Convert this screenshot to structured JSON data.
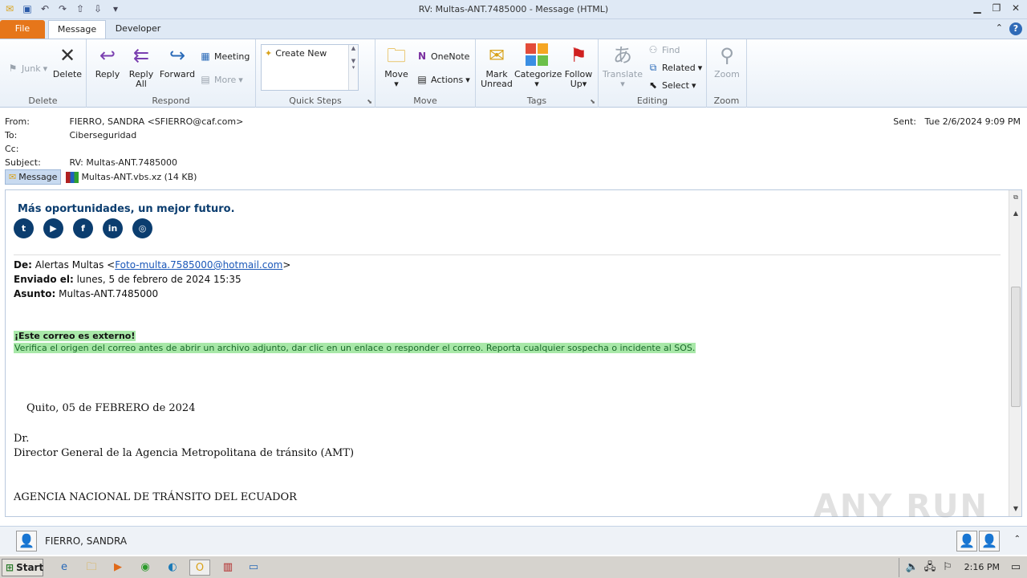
{
  "window": {
    "title": "RV: Multas-ANT.7485000 - Message (HTML)"
  },
  "tabs": [
    {
      "label": "File"
    },
    {
      "label": "Message"
    },
    {
      "label": "Developer"
    }
  ],
  "ribbon": {
    "delete_group": {
      "label": "Delete",
      "junk": "Junk",
      "delete": "Delete"
    },
    "respond_group": {
      "label": "Respond",
      "reply": "Reply",
      "reply_all_1": "Reply",
      "reply_all_2": "All",
      "forward": "Forward",
      "meeting": "Meeting",
      "more": "More"
    },
    "quicksteps_group": {
      "label": "Quick Steps",
      "create_new": "Create New"
    },
    "move_group": {
      "label": "Move",
      "move": "Move",
      "onenote": "OneNote",
      "actions": "Actions"
    },
    "tags_group": {
      "label": "Tags",
      "mark_unread_1": "Mark",
      "mark_unread_2": "Unread",
      "categorize": "Categorize",
      "follow_up_1": "Follow",
      "follow_up_2": "Up"
    },
    "editing_group": {
      "label": "Editing",
      "translate": "Translate",
      "find": "Find",
      "related": "Related",
      "select": "Select"
    },
    "zoom_group": {
      "label": "Zoom",
      "zoom": "Zoom"
    }
  },
  "header": {
    "from_label": "From:",
    "from_value": "FIERRO, SANDRA <SFIERRO@caf.com>",
    "to_label": "To:",
    "to_value": "Ciberseguridad",
    "cc_label": "Cc:",
    "subject_label": "Subject:",
    "subject_value": "RV: Multas-ANT.7485000",
    "sent_label": "Sent:",
    "sent_value": "Tue 2/6/2024 9:09 PM",
    "message_chip": "Message",
    "attachment": "Multas-ANT.vbs.xz (14 KB)"
  },
  "body": {
    "slogan": "Más oportunidades, un mejor futuro.",
    "social": [
      "t",
      "▶",
      "f",
      "in",
      "◎"
    ],
    "de_label": "De:",
    "de_name": "Alertas Multas <",
    "de_email": "Foto-multa.7585000@hotmail.com",
    "de_close": ">",
    "enviado_label": "Enviado el:",
    "enviado_value": "lunes, 5 de febrero de 2024 15:35",
    "asunto_label": "Asunto:",
    "asunto_value": "Multas-ANT.7485000",
    "external_title": "¡Este correo es externo!",
    "external_text": "Verifica el origen del correo antes de abrir un archivo adjunto, dar clic en un enlace o responder el correo. Reporta cualquier sospecha o incidente al SOS.",
    "city_date": "Quito, 05 de FEBRERO de 2024",
    "dr": "Dr.",
    "director": "Director General de la Agencia Metropolitana de tránsito (AMT)",
    "agency": "AGENCIA NACIONAL DE TRÁNSITO DEL ECUADOR"
  },
  "watermark": "ANY RUN",
  "people_pane": {
    "name": "FIERRO, SANDRA"
  },
  "taskbar": {
    "start": "Start",
    "clock": "2:16 PM"
  }
}
